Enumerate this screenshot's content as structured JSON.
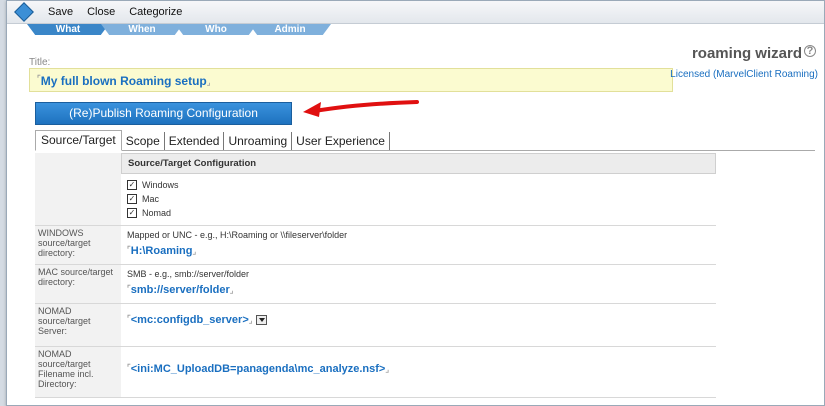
{
  "toolbar": {
    "save": "Save",
    "close": "Close",
    "categorize": "Categorize"
  },
  "navtabs": [
    "What",
    "When",
    "Who",
    "Admin"
  ],
  "title": {
    "label": "Title:",
    "value": "My full blown Roaming setup"
  },
  "product": {
    "name": "roaming wizard",
    "help": "?",
    "license": "Licensed (MarvelClient Roaming)"
  },
  "publish_button": "(Re)Publish Roaming Configuration",
  "tabs": [
    "Source/Target",
    "Scope",
    "Extended",
    "Unroaming",
    "User Experience"
  ],
  "config": {
    "header": "Source/Target Configuration",
    "platforms": [
      {
        "label": "Windows",
        "checked": true
      },
      {
        "label": "Mac",
        "checked": true
      },
      {
        "label": "Nomad",
        "checked": true
      }
    ],
    "rows": [
      {
        "label": "WINDOWS source/target directory:",
        "hint": "Mapped or UNC - e.g., H:\\Roaming or \\\\fileserver\\folder",
        "value": "H:\\Roaming"
      },
      {
        "label": "MAC source/target directory:",
        "hint": "SMB - e.g., smb://server/folder",
        "value": "smb://server/folder"
      },
      {
        "label": "NOMAD source/target Server:",
        "hint": "",
        "value": "<mc:configdb_server>"
      },
      {
        "label": "NOMAD source/target Filename incl. Directory:",
        "hint": "",
        "value": "<ini:MC_UploadDB=panagenda\\mc_analyze.nsf>"
      }
    ]
  },
  "colors": {
    "accent": "#1a6fc0",
    "button": "#2a82cf",
    "arrow": "#e01010"
  }
}
